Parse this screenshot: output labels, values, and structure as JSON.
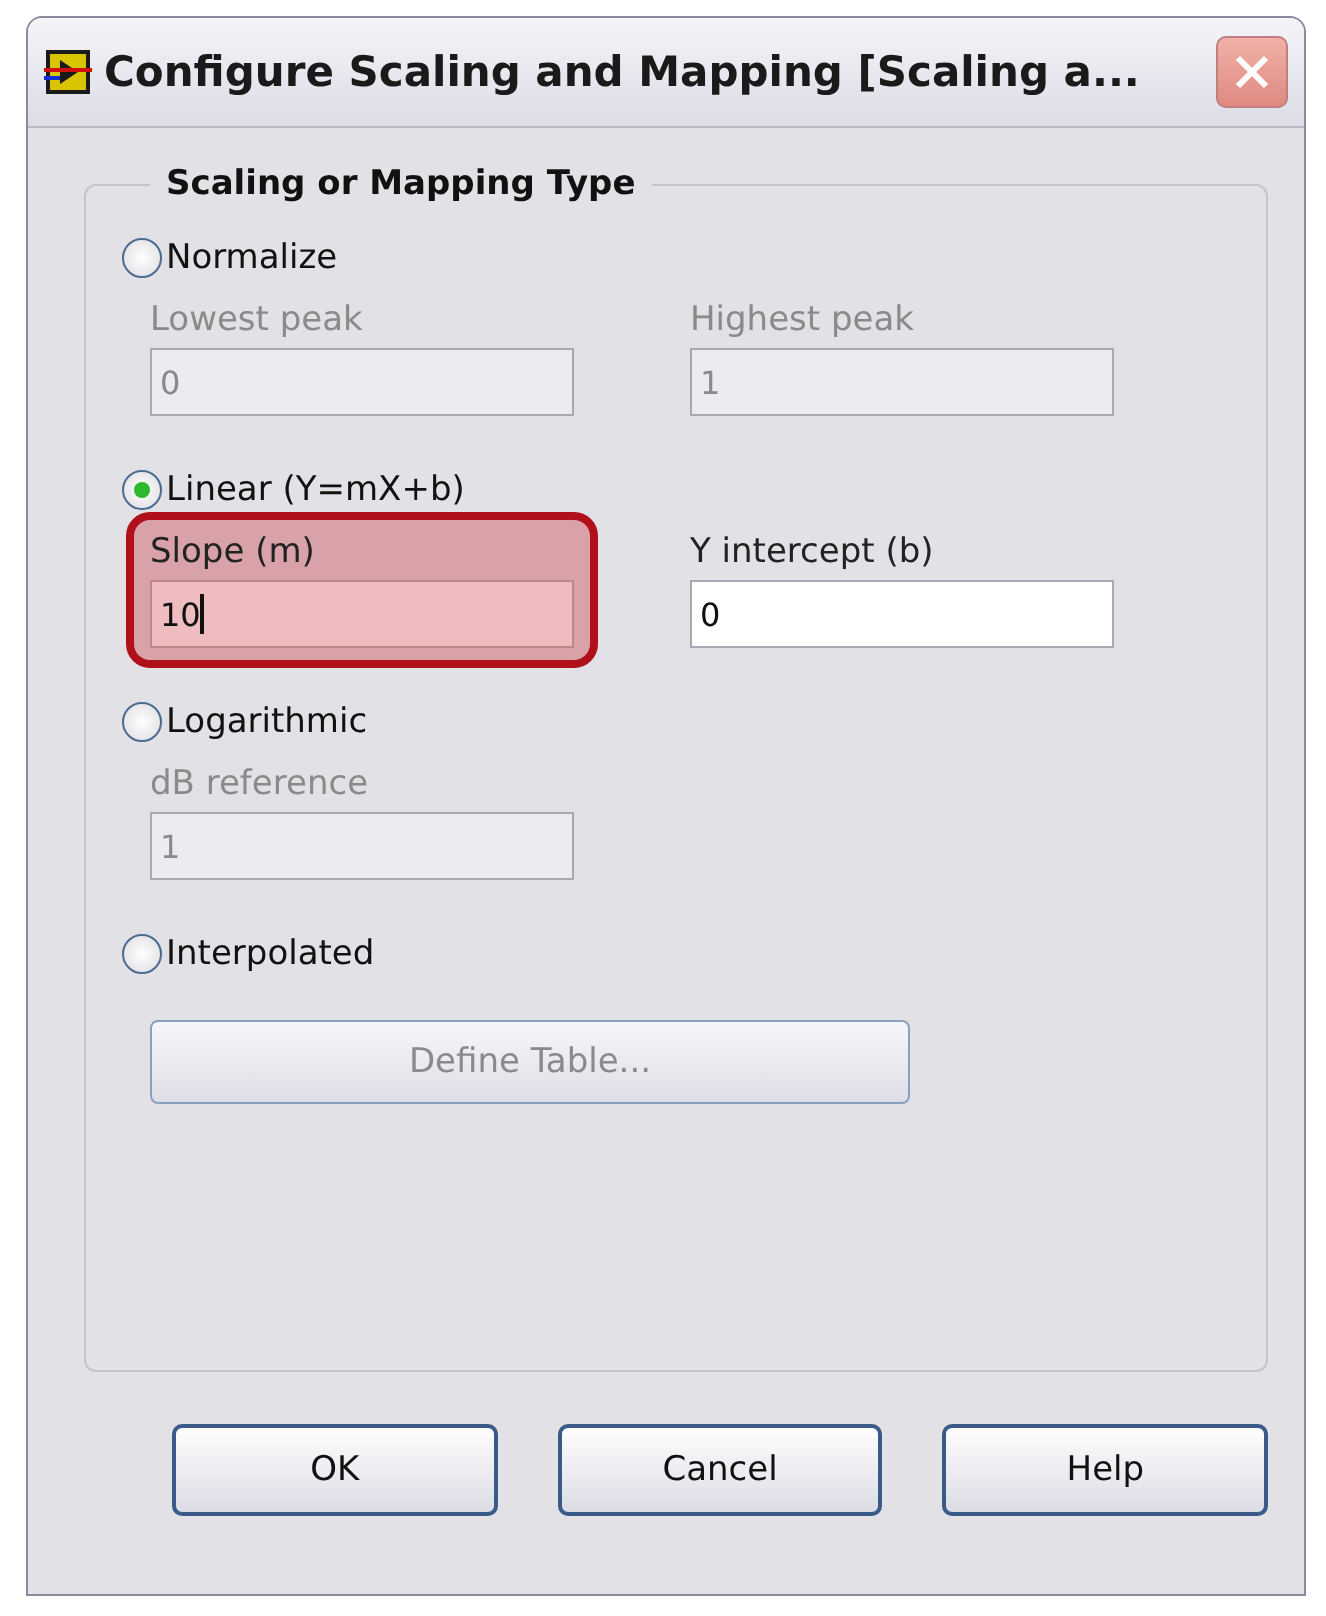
{
  "window": {
    "title": "Configure Scaling and Mapping [Scaling a..."
  },
  "group": {
    "title": "Scaling or Mapping Type"
  },
  "options": [
    {
      "label": "Normalize",
      "selected": false,
      "fields": [
        {
          "label": "Lowest peak",
          "value": "0",
          "disabled": true,
          "highlighted": false
        },
        {
          "label": "Highest peak",
          "value": "1",
          "disabled": true,
          "highlighted": false
        }
      ]
    },
    {
      "label": "Linear (Y=mX+b)",
      "selected": true,
      "fields": [
        {
          "label": "Slope (m)",
          "value": "10",
          "disabled": false,
          "highlighted": true
        },
        {
          "label": "Y intercept (b)",
          "value": "0",
          "disabled": false,
          "highlighted": false
        }
      ]
    },
    {
      "label": "Logarithmic",
      "selected": false,
      "fields": [
        {
          "label": "dB reference",
          "value": "1",
          "disabled": true,
          "highlighted": false
        }
      ]
    },
    {
      "label": "Interpolated",
      "selected": false,
      "button": {
        "label": "Define Table...",
        "disabled": true
      }
    }
  ],
  "buttons": [
    "OK",
    "Cancel",
    "Help"
  ]
}
